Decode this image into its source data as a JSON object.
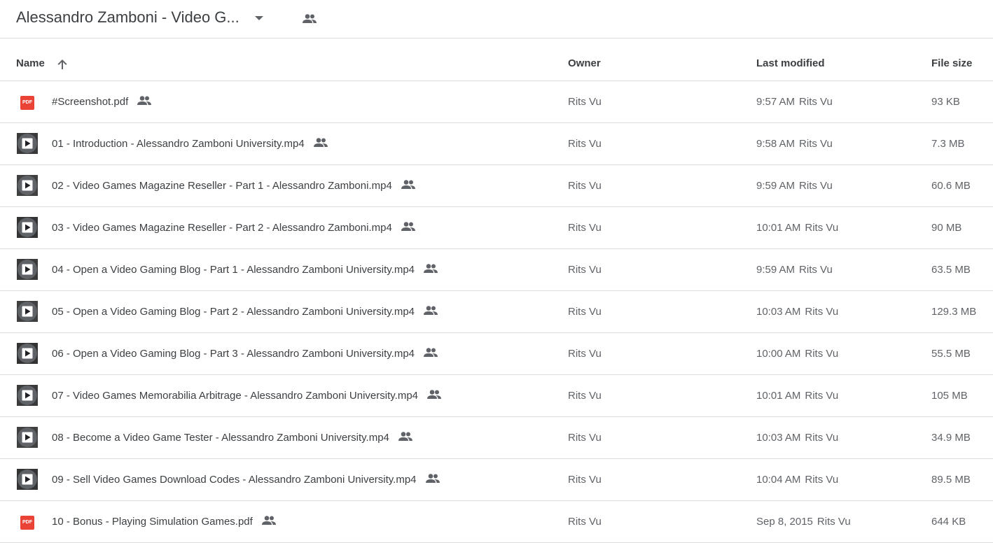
{
  "header": {
    "folder_title": "Alessandro Zamboni - Video G...",
    "caret_icon": "caret-down-icon",
    "shared_icon": "people-icon"
  },
  "columns": {
    "name": "Name",
    "owner": "Owner",
    "last_modified": "Last modified",
    "file_size": "File size",
    "sort_icon": "arrow-up-icon"
  },
  "files": [
    {
      "name": "#Screenshot.pdf",
      "type": "pdf",
      "icon": "pdf-icon",
      "owner": "Rits Vu",
      "modified_time": "9:57 AM",
      "modified_by": "Rits Vu",
      "size": "93 KB"
    },
    {
      "name": "01 - Introduction - Alessandro Zamboni University.mp4",
      "type": "video",
      "icon": "video-play-icon",
      "owner": "Rits Vu",
      "modified_time": "9:58 AM",
      "modified_by": "Rits Vu",
      "size": "7.3 MB"
    },
    {
      "name": "02 - Video Games Magazine Reseller - Part 1 - Alessandro Zamboni.mp4",
      "type": "video",
      "icon": "video-play-icon",
      "owner": "Rits Vu",
      "modified_time": "9:59 AM",
      "modified_by": "Rits Vu",
      "size": "60.6 MB"
    },
    {
      "name": "03 - Video Games Magazine Reseller - Part 2 - Alessandro Zamboni.mp4",
      "type": "video",
      "icon": "video-play-icon",
      "owner": "Rits Vu",
      "modified_time": "10:01 AM",
      "modified_by": "Rits Vu",
      "size": "90 MB"
    },
    {
      "name": "04 - Open a Video Gaming Blog - Part 1 - Alessandro Zamboni University.mp4",
      "type": "video",
      "icon": "video-play-icon",
      "owner": "Rits Vu",
      "modified_time": "9:59 AM",
      "modified_by": "Rits Vu",
      "size": "63.5 MB"
    },
    {
      "name": "05 - Open a Video Gaming Blog - Part 2 - Alessandro Zamboni University.mp4",
      "type": "video",
      "icon": "video-play-icon",
      "owner": "Rits Vu",
      "modified_time": "10:03 AM",
      "modified_by": "Rits Vu",
      "size": "129.3 MB"
    },
    {
      "name": "06 - Open a Video Gaming Blog - Part 3 - Alessandro Zamboni University.mp4",
      "type": "video",
      "icon": "video-play-icon",
      "owner": "Rits Vu",
      "modified_time": "10:00 AM",
      "modified_by": "Rits Vu",
      "size": "55.5 MB"
    },
    {
      "name": "07 - Video Games Memorabilia Arbitrage - Alessandro Zamboni University.mp4",
      "type": "video",
      "icon": "video-play-icon",
      "owner": "Rits Vu",
      "modified_time": "10:01 AM",
      "modified_by": "Rits Vu",
      "size": "105 MB"
    },
    {
      "name": "08 - Become a Video Game Tester - Alessandro Zamboni University.mp4",
      "type": "video",
      "icon": "video-play-icon",
      "owner": "Rits Vu",
      "modified_time": "10:03 AM",
      "modified_by": "Rits Vu",
      "size": "34.9 MB"
    },
    {
      "name": "09 - Sell Video Games Download Codes - Alessandro Zamboni University.mp4",
      "type": "video",
      "icon": "video-play-icon",
      "owner": "Rits Vu",
      "modified_time": "10:04 AM",
      "modified_by": "Rits Vu",
      "size": "89.5 MB"
    },
    {
      "name": "10 - Bonus - Playing Simulation Games.pdf",
      "type": "pdf",
      "icon": "pdf-icon",
      "owner": "Rits Vu",
      "modified_time": "Sep 8, 2015",
      "modified_by": "Rits Vu",
      "size": "644 KB"
    }
  ],
  "pdf_badge_text": "PDF",
  "colors": {
    "text": "#3c4043",
    "muted": "#5f6368",
    "divider": "#dadce0",
    "pdf_red": "#ea4335"
  }
}
